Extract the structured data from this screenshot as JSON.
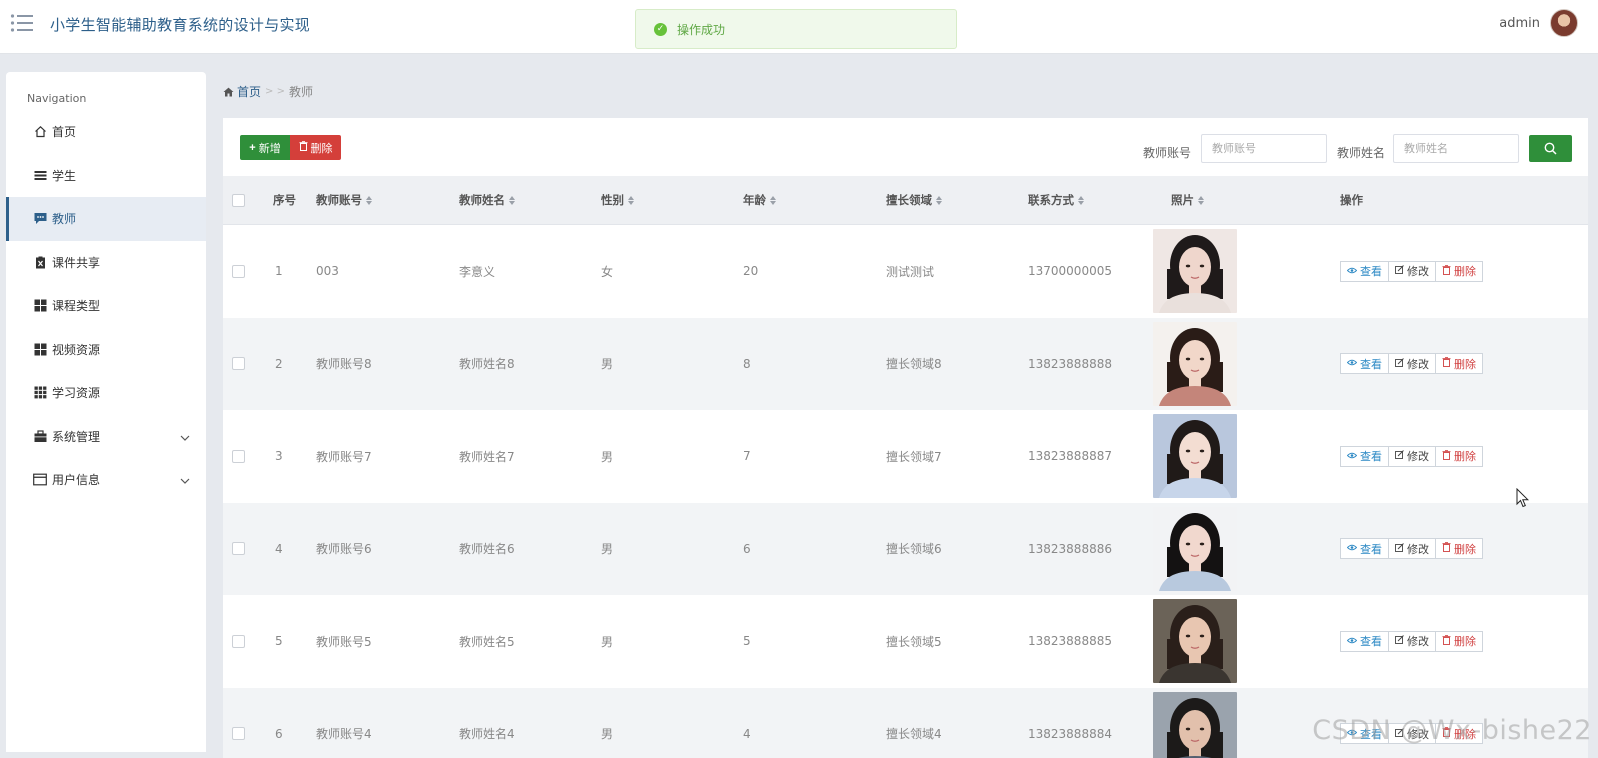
{
  "header": {
    "title": "小学生智能辅助教育系统的设计与实现",
    "toast_message": "操作成功",
    "username": "admin"
  },
  "sidebar": {
    "nav_title": "Navigation",
    "items": [
      {
        "label": "首页",
        "icon": "home-icon"
      },
      {
        "label": "学生",
        "icon": "list-icon"
      },
      {
        "label": "教师",
        "icon": "chat-icon",
        "active": true
      },
      {
        "label": "课件共享",
        "icon": "clipboard-icon"
      },
      {
        "label": "课程类型",
        "icon": "grid-icon"
      },
      {
        "label": "视频资源",
        "icon": "grid-icon"
      },
      {
        "label": "学习资源",
        "icon": "grid-9-icon"
      },
      {
        "label": "系统管理",
        "icon": "briefcase-icon",
        "expandable": true
      },
      {
        "label": "用户信息",
        "icon": "card-icon",
        "expandable": true
      }
    ]
  },
  "breadcrumb": {
    "home": "首页",
    "separator": "> >",
    "current": "教师"
  },
  "toolbar": {
    "add_label": "新增",
    "delete_label": "删除",
    "search_account_label": "教师账号",
    "search_account_placeholder": "教师账号",
    "search_name_label": "教师姓名",
    "search_name_placeholder": "教师姓名"
  },
  "table": {
    "headers": {
      "index": "序号",
      "account": "教师账号",
      "name": "教师姓名",
      "gender": "性别",
      "age": "年龄",
      "field": "擅长领域",
      "contact": "联系方式",
      "photo": "照片",
      "actions": "操作"
    },
    "action_labels": {
      "view": "查看",
      "edit": "修改",
      "remove": "删除"
    },
    "rows": [
      {
        "index": "1",
        "account": "003",
        "name": "李意义",
        "gender": "女",
        "age": "20",
        "field": "测试测试",
        "contact": "13700000005"
      },
      {
        "index": "2",
        "account": "教师账号8",
        "name": "教师姓名8",
        "gender": "男",
        "age": "8",
        "field": "擅长领域8",
        "contact": "13823888888"
      },
      {
        "index": "3",
        "account": "教师账号7",
        "name": "教师姓名7",
        "gender": "男",
        "age": "7",
        "field": "擅长领域7",
        "contact": "13823888887"
      },
      {
        "index": "4",
        "account": "教师账号6",
        "name": "教师姓名6",
        "gender": "男",
        "age": "6",
        "field": "擅长领域6",
        "contact": "13823888886"
      },
      {
        "index": "5",
        "account": "教师账号5",
        "name": "教师姓名5",
        "gender": "男",
        "age": "5",
        "field": "擅长领域5",
        "contact": "13823888885"
      },
      {
        "index": "6",
        "account": "教师账号4",
        "name": "教师姓名4",
        "gender": "男",
        "age": "4",
        "field": "擅长领域4",
        "contact": "13823888884"
      }
    ]
  },
  "watermark": "CSDN @Wx-bishe22",
  "colors": {
    "primary": "#2d5f8a",
    "success": "#2f8f3a",
    "danger": "#d43f3a",
    "toast_bg": "#f0f9eb",
    "toast_text": "#5fa845"
  }
}
